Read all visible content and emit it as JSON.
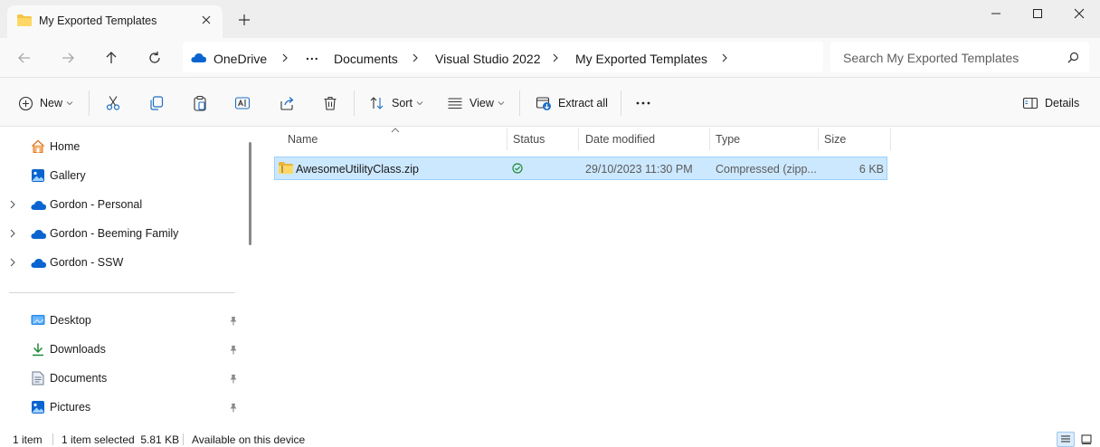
{
  "window": {
    "tab_title": "My Exported Templates",
    "minimize_icon": "minimize-icon",
    "maximize_icon": "maximize-icon",
    "close_icon": "close-icon"
  },
  "address": {
    "crumbs": [
      "OneDrive",
      "...",
      "Documents",
      "Visual Studio 2022",
      "My Exported Templates"
    ],
    "search_placeholder": "Search My Exported Templates"
  },
  "toolbar": {
    "new_label": "New",
    "sort_label": "Sort",
    "view_label": "View",
    "extract_label": "Extract all",
    "more_label": "...",
    "details_label": "Details"
  },
  "nav": {
    "top_items": [
      {
        "label": "Home",
        "icon": "home-icon"
      },
      {
        "label": "Gallery",
        "icon": "gallery-icon"
      },
      {
        "label": "Gordon - Personal",
        "icon": "onedrive-cloud-icon"
      },
      {
        "label": "Gordon - Beeming Family",
        "icon": "onedrive-cloud-icon"
      },
      {
        "label": "Gordon - SSW",
        "icon": "onedrive-cloud-icon"
      }
    ],
    "pinned_items": [
      {
        "label": "Desktop",
        "icon": "desktop-icon"
      },
      {
        "label": "Downloads",
        "icon": "downloads-icon"
      },
      {
        "label": "Documents",
        "icon": "documents-icon"
      },
      {
        "label": "Pictures",
        "icon": "pictures-icon"
      }
    ]
  },
  "file_list": {
    "columns": [
      "Name",
      "Status",
      "Date modified",
      "Type",
      "Size"
    ],
    "rows": [
      {
        "name": "AwesomeUtilityClass.zip",
        "status": "synced",
        "date_modified": "29/10/2023 11:30 PM",
        "type": "Compressed (zipp...",
        "size": "6 KB"
      }
    ]
  },
  "status_bar": {
    "item_count": "1 item",
    "selection": "1 item selected  5.81 KB",
    "availability": "Available on this device"
  },
  "colors": {
    "selection_bg": "#cce8ff",
    "selection_border": "#99d1ff",
    "onedrive_blue": "#0a64d0",
    "folder_yellow": "#f4c542",
    "status_green": "#1e8a36"
  }
}
